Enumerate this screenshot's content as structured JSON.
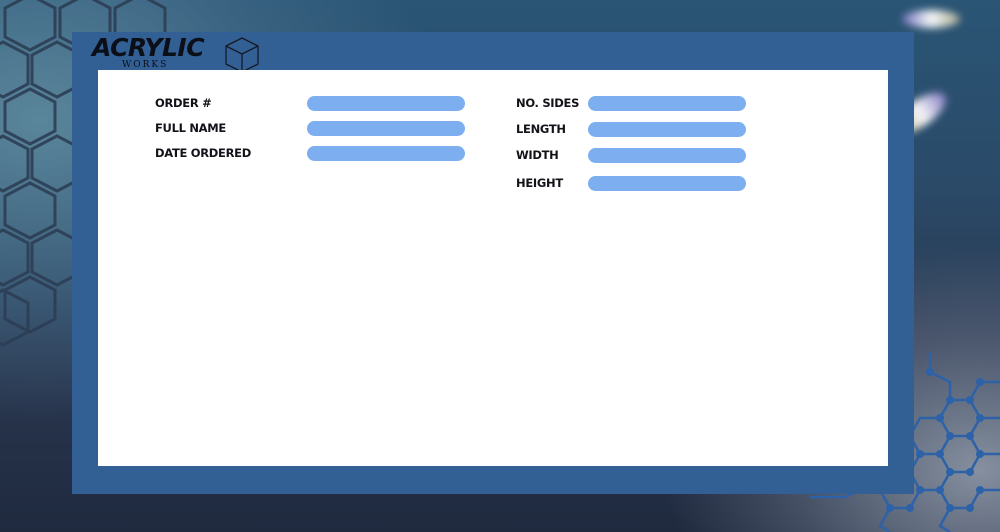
{
  "brand": {
    "title": "ACRYLIC",
    "subtitle": "WORKS"
  },
  "icons": {
    "logo": "cube-icon"
  },
  "colors": {
    "frame": "#325f94",
    "sheet": "#ffffff",
    "input": "#7daff0",
    "label": "#121318"
  },
  "form": {
    "order_number": {
      "label": "ORDER #",
      "value": ""
    },
    "full_name": {
      "label": "FULL NAME",
      "value": ""
    },
    "date_ordered": {
      "label": "DATE ORDERED",
      "value": ""
    },
    "no_sides": {
      "label": "NO. SIDES",
      "value": ""
    },
    "length": {
      "label": "LENGTH",
      "value": ""
    },
    "width": {
      "label": "WIDTH",
      "value": ""
    },
    "height": {
      "label": "HEIGHT",
      "value": ""
    }
  }
}
